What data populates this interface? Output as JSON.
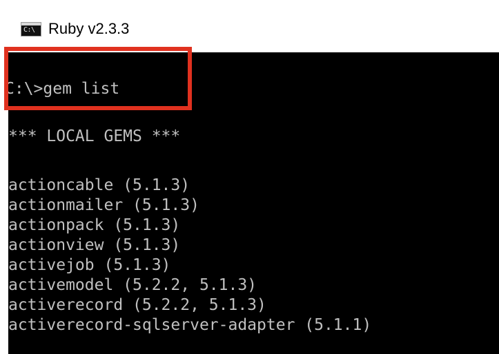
{
  "window": {
    "title": "Ruby v2.3.3",
    "icon": "cmd-icon",
    "icon_text": "C:\\"
  },
  "terminal": {
    "prompt_line": "C:\\>gem list",
    "header_line": "*** LOCAL GEMS ***",
    "gems": [
      "actioncable (5.1.3)",
      "actionmailer (5.1.3)",
      "actionpack (5.1.3)",
      "actionview (5.1.3)",
      "activejob (5.1.3)",
      "activemodel (5.2.2, 5.1.3)",
      "activerecord (5.2.2, 5.1.3)",
      "activerecord-sqlserver-adapter (5.1.1)"
    ],
    "background_color": "#000000",
    "text_color": "#c0c0c0"
  },
  "annotation": {
    "highlight_color": "#e0311f"
  }
}
